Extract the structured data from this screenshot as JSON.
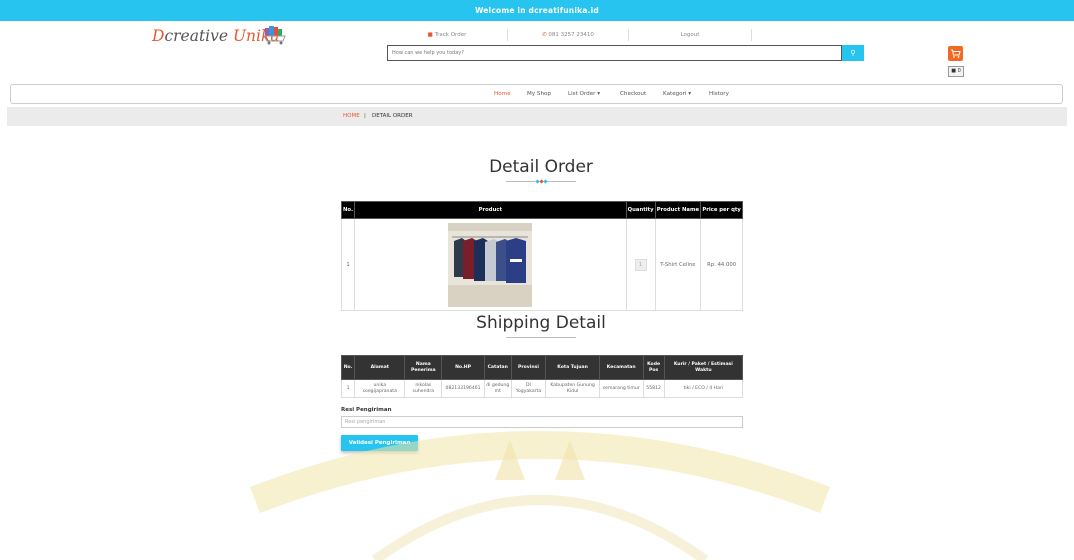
{
  "topbar": {
    "welcome": "Welcome in dcreatifunika.id"
  },
  "brand": {
    "d": "D",
    "creative": "creative ",
    "unika": "Unika"
  },
  "toplinks": {
    "track": "Track Order",
    "phone": "081 3257 23410",
    "logout": "Logout"
  },
  "search": {
    "placeholder": "How can we help you today?",
    "button_icon": "search-icon"
  },
  "cart": {
    "icon": "cart-icon",
    "count_icon": "bag-icon",
    "count": "0"
  },
  "nav": {
    "items": [
      "Home",
      "My Shop",
      "List Order ▾",
      "Checkout",
      "Kategori ▾",
      "History"
    ]
  },
  "breadcrumb": {
    "home": "HOME",
    "sep": "|",
    "current": "DETAIL ORDER"
  },
  "order": {
    "title": "Detail Order",
    "headers": [
      "No.",
      "Product",
      "Quantity",
      "Product Name",
      "Price per qty"
    ],
    "rows": [
      {
        "no": "1",
        "qty": "1",
        "name": "T-Shirt Celine",
        "price": "Rp. 44.000"
      }
    ]
  },
  "shipping": {
    "title": "Shipping Detail",
    "headers": [
      "No.",
      "Alamat",
      "Nama Penerima",
      "No.HP",
      "Catatan",
      "Provinsi",
      "Kota Tujuan",
      "Kecamatan",
      "Kode Pos",
      "Kurir / Paket / Estimasi Waktu"
    ],
    "rows": [
      [
        "1",
        "unika soegijapranata",
        "nikolas suhendra",
        "082133196461",
        "di gedung mt",
        "DI Yogyakarta",
        "Kabupaten Gunung Kidul",
        "semarang timur",
        "55812",
        "tiki / ECO / 4 Hari"
      ]
    ]
  },
  "resi": {
    "label": "Resi Pengiriman",
    "placeholder": "Resi pengiriman"
  },
  "validate": {
    "label": "Validasi Pengiriman"
  },
  "colors": {
    "accent": "#26c4ee",
    "brand": "#e8572d",
    "cart": "#f26a21"
  }
}
